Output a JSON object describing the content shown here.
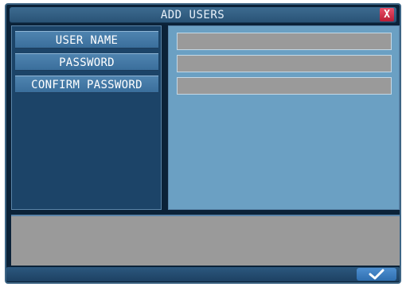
{
  "dialog": {
    "title": "ADD USERS",
    "close_label": "X"
  },
  "fields": [
    {
      "label": "USER NAME",
      "value": ""
    },
    {
      "label": "PASSWORD",
      "value": ""
    },
    {
      "label": "CONFIRM PASSWORD",
      "value": ""
    }
  ],
  "message": "",
  "buttons": {
    "ok_icon": "checkmark-icon"
  },
  "colors": {
    "window_bg": "#0b2238",
    "title_bar": "#2a5376",
    "label_button": "#3a6e9b",
    "field_bg": "#9a9a9a",
    "right_panel": "#6ba0c3",
    "close_button": "#b91c34"
  }
}
